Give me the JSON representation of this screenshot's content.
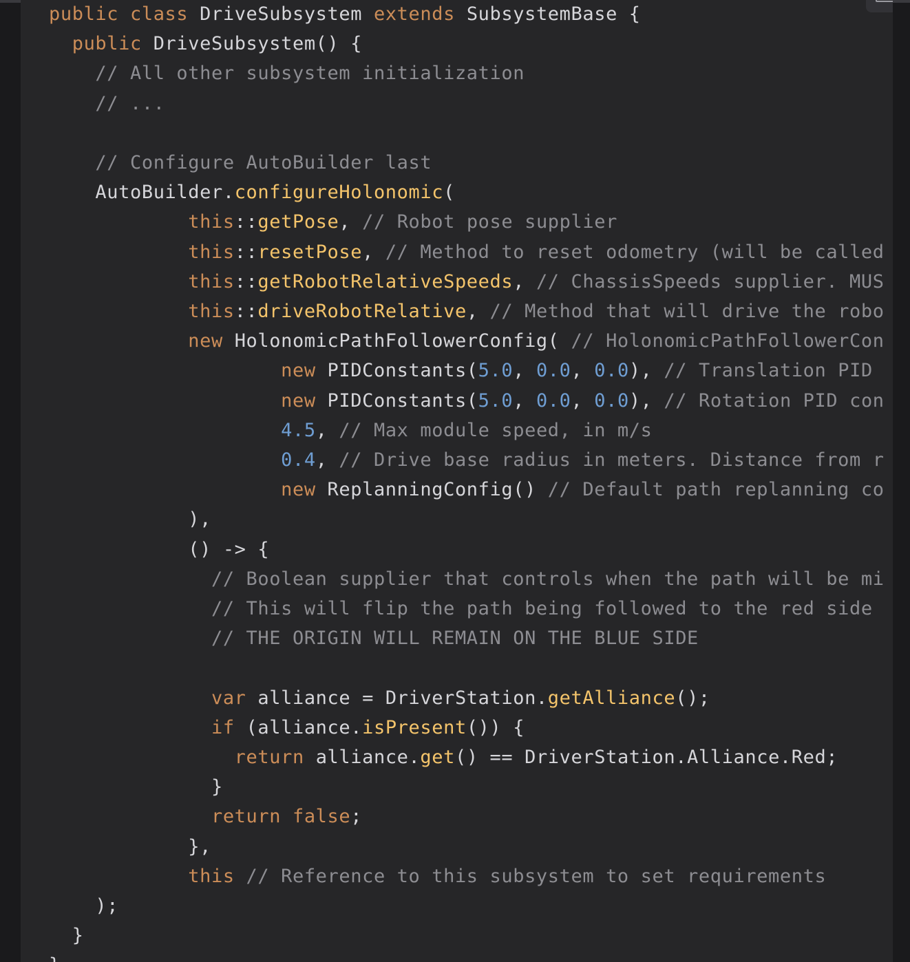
{
  "code_block": {
    "language": "java",
    "lines": [
      [
        {
          "t": "public class ",
          "c": "kw"
        },
        {
          "t": "DriveSubsystem ",
          "c": "cl"
        },
        {
          "t": "extends ",
          "c": "kw"
        },
        {
          "t": "SubsystemBase {",
          "c": "cl"
        }
      ],
      [
        {
          "t": "  public ",
          "c": "kw"
        },
        {
          "t": "DriveSubsystem() {",
          "c": "cl"
        }
      ],
      [
        {
          "t": "    // All other subsystem initialization",
          "c": "cm"
        }
      ],
      [
        {
          "t": "    // ...",
          "c": "cm"
        }
      ],
      [],
      [
        {
          "t": "    // Configure AutoBuilder last",
          "c": "cm"
        }
      ],
      [
        {
          "t": "    AutoBuilder.",
          "c": "cl"
        },
        {
          "t": "configureHolonomic",
          "c": "fn"
        },
        {
          "t": "(",
          "c": "op"
        }
      ],
      [
        {
          "t": "            this",
          "c": "kw"
        },
        {
          "t": "::",
          "c": "op"
        },
        {
          "t": "getPose",
          "c": "fn"
        },
        {
          "t": ", ",
          "c": "op"
        },
        {
          "t": "// Robot pose supplier",
          "c": "cm"
        }
      ],
      [
        {
          "t": "            this",
          "c": "kw"
        },
        {
          "t": "::",
          "c": "op"
        },
        {
          "t": "resetPose",
          "c": "fn"
        },
        {
          "t": ", ",
          "c": "op"
        },
        {
          "t": "// Method to reset odometry (will be called i",
          "c": "cm"
        }
      ],
      [
        {
          "t": "            this",
          "c": "kw"
        },
        {
          "t": "::",
          "c": "op"
        },
        {
          "t": "getRobotRelativeSpeeds",
          "c": "fn"
        },
        {
          "t": ", ",
          "c": "op"
        },
        {
          "t": "// ChassisSpeeds supplier. MUST",
          "c": "cm"
        }
      ],
      [
        {
          "t": "            this",
          "c": "kw"
        },
        {
          "t": "::",
          "c": "op"
        },
        {
          "t": "driveRobotRelative",
          "c": "fn"
        },
        {
          "t": ", ",
          "c": "op"
        },
        {
          "t": "// Method that will drive the robot",
          "c": "cm"
        }
      ],
      [
        {
          "t": "            new ",
          "c": "kw"
        },
        {
          "t": "HolonomicPathFollowerConfig( ",
          "c": "cl"
        },
        {
          "t": "// HolonomicPathFollowerConfi",
          "c": "cm"
        }
      ],
      [
        {
          "t": "                    new ",
          "c": "kw"
        },
        {
          "t": "PIDConstants(",
          "c": "cl"
        },
        {
          "t": "5.0",
          "c": "nm"
        },
        {
          "t": ", ",
          "c": "op"
        },
        {
          "t": "0.0",
          "c": "nm"
        },
        {
          "t": ", ",
          "c": "op"
        },
        {
          "t": "0.0",
          "c": "nm"
        },
        {
          "t": "), ",
          "c": "op"
        },
        {
          "t": "// Translation PID co",
          "c": "cm"
        }
      ],
      [
        {
          "t": "                    new ",
          "c": "kw"
        },
        {
          "t": "PIDConstants(",
          "c": "cl"
        },
        {
          "t": "5.0",
          "c": "nm"
        },
        {
          "t": ", ",
          "c": "op"
        },
        {
          "t": "0.0",
          "c": "nm"
        },
        {
          "t": ", ",
          "c": "op"
        },
        {
          "t": "0.0",
          "c": "nm"
        },
        {
          "t": "), ",
          "c": "op"
        },
        {
          "t": "// Rotation PID const",
          "c": "cm"
        }
      ],
      [
        {
          "t": "                    4.5",
          "c": "nm"
        },
        {
          "t": ", ",
          "c": "op"
        },
        {
          "t": "// Max module speed, in m/s",
          "c": "cm"
        }
      ],
      [
        {
          "t": "                    0.4",
          "c": "nm"
        },
        {
          "t": ", ",
          "c": "op"
        },
        {
          "t": "// Drive base radius in meters. Distance from rob",
          "c": "cm"
        }
      ],
      [
        {
          "t": "                    new ",
          "c": "kw"
        },
        {
          "t": "ReplanningConfig() ",
          "c": "cl"
        },
        {
          "t": "// Default path replanning conf",
          "c": "cm"
        }
      ],
      [
        {
          "t": "            ),",
          "c": "op"
        }
      ],
      [
        {
          "t": "            () -> {",
          "c": "op"
        }
      ],
      [
        {
          "t": "              // Boolean supplier that controls when the path will be mirr",
          "c": "cm"
        }
      ],
      [
        {
          "t": "              // This will flip the path being followed to the red side of",
          "c": "cm"
        }
      ],
      [
        {
          "t": "              // THE ORIGIN WILL REMAIN ON THE BLUE SIDE",
          "c": "cm"
        }
      ],
      [],
      [
        {
          "t": "              var ",
          "c": "kw"
        },
        {
          "t": "alliance = DriverStation.",
          "c": "cl"
        },
        {
          "t": "getAlliance",
          "c": "fn"
        },
        {
          "t": "();",
          "c": "op"
        }
      ],
      [
        {
          "t": "              if ",
          "c": "kw"
        },
        {
          "t": "(alliance.",
          "c": "cl"
        },
        {
          "t": "isPresent",
          "c": "fn"
        },
        {
          "t": "()) {",
          "c": "op"
        }
      ],
      [
        {
          "t": "                return ",
          "c": "kw"
        },
        {
          "t": "alliance.",
          "c": "cl"
        },
        {
          "t": "get",
          "c": "fn"
        },
        {
          "t": "() == DriverStation.Alliance.Red;",
          "c": "cl"
        }
      ],
      [
        {
          "t": "              }",
          "c": "op"
        }
      ],
      [
        {
          "t": "              return false",
          "c": "kw"
        },
        {
          "t": ";",
          "c": "op"
        }
      ],
      [
        {
          "t": "            },",
          "c": "op"
        }
      ],
      [
        {
          "t": "            this ",
          "c": "kw"
        },
        {
          "t": "// Reference to this subsystem to set requirements",
          "c": "cm"
        }
      ],
      [
        {
          "t": "    );",
          "c": "op"
        }
      ],
      [
        {
          "t": "  }",
          "c": "op"
        }
      ],
      [
        {
          "t": "}",
          "c": "op"
        }
      ]
    ]
  },
  "toolbar": {
    "copy_icon": "copy-icon"
  },
  "colors": {
    "background": "#262628",
    "keyword": "#cc8d58",
    "function": "#f4c46b",
    "number": "#6f9ed3",
    "comment": "#8d8d92",
    "text": "#d6d6da"
  }
}
